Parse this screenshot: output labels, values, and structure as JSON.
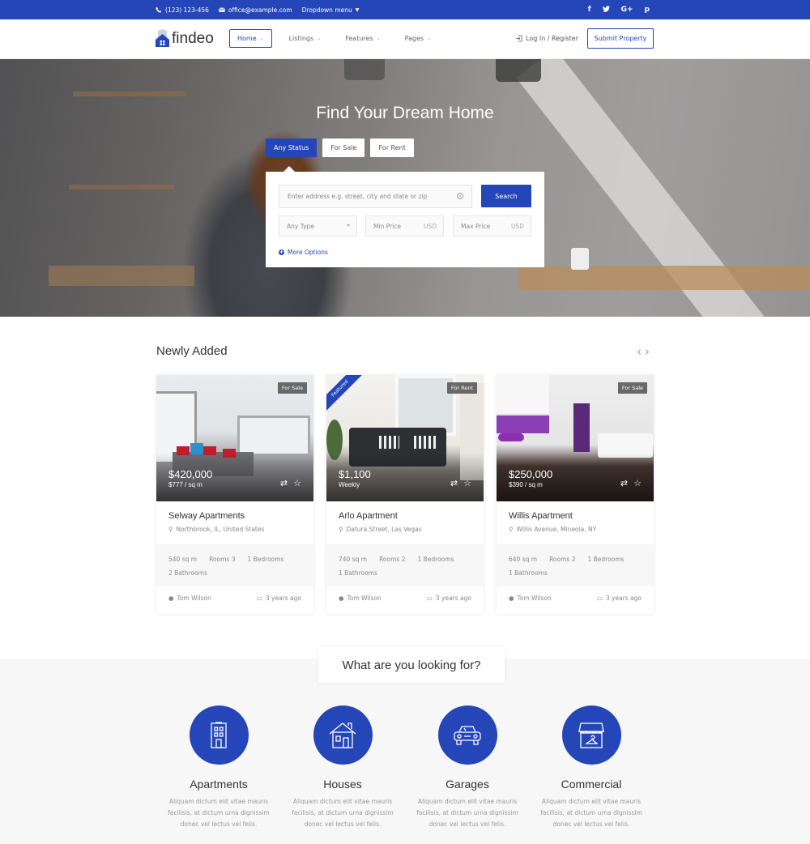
{
  "topbar": {
    "phone": "(123) 123-456",
    "email": "office@example.com",
    "dropdown": "Dropdown menu",
    "social": [
      "f",
      "t",
      "G+",
      "p"
    ]
  },
  "header": {
    "logo": "findeo",
    "nav": [
      {
        "label": "Home",
        "active": true
      },
      {
        "label": "Listings",
        "active": false
      },
      {
        "label": "Features",
        "active": false
      },
      {
        "label": "Pages",
        "active": false
      }
    ],
    "login": "Log In / Register",
    "submit": "Submit Property"
  },
  "hero": {
    "title": "Find Your Dream Home",
    "tabs": [
      {
        "label": "Any Status",
        "active": true
      },
      {
        "label": "For Sale",
        "active": false
      },
      {
        "label": "For Rent",
        "active": false
      }
    ],
    "address_placeholder": "Enter address e.g. street, city and state or zip",
    "search_label": "Search",
    "type_placeholder": "Any Type",
    "min_price_placeholder": "Min Price",
    "max_price_placeholder": "Max Price",
    "currency": "USD",
    "more_options": "More Options"
  },
  "newly_added": {
    "title": "Newly Added",
    "listings": [
      {
        "name": "Selway Apartments",
        "location": "Northbrook, IL, United States",
        "price": "$420,000",
        "sub": "$777 / sq m",
        "badge": "For Sale",
        "featured": false,
        "area": "540 sq m",
        "rooms": "Rooms 3",
        "bedrooms": "1 Bedrooms",
        "bathrooms": "2 Bathrooms",
        "agent": "Tom Wilson",
        "date": "3 years ago"
      },
      {
        "name": "Arlo Apartment",
        "location": "Datura Street, Las Vegas",
        "price": "$1,100",
        "sub": "Weekly",
        "badge": "For Rent",
        "featured": true,
        "featured_label": "Featured",
        "area": "740 sq m",
        "rooms": "Rooms 2",
        "bedrooms": "1 Bedrooms",
        "bathrooms": "1 Bathrooms",
        "agent": "Tom Wilson",
        "date": "3 years ago"
      },
      {
        "name": "Willis Apartment",
        "location": "Willis Avenue, Mineola, NY",
        "price": "$250,000",
        "sub": "$390 / sq m",
        "badge": "For Sale",
        "featured": false,
        "area": "640 sq m",
        "rooms": "Rooms 2",
        "bedrooms": "1 Bedrooms",
        "bathrooms": "1 Bathrooms",
        "agent": "Tom Wilson",
        "date": "3 years ago"
      }
    ]
  },
  "looking_for": {
    "title": "What are you looking for?",
    "categories": [
      {
        "title": "Apartments",
        "icon": "building-icon",
        "desc": "Aliquam dictum elit vitae mauris facilisis, at dictum urna dignissim donec vel lectus vel felis."
      },
      {
        "title": "Houses",
        "icon": "house-icon",
        "desc": "Aliquam dictum elit vitae mauris facilisis, at dictum urna dignissim donec vel lectus vel felis."
      },
      {
        "title": "Garages",
        "icon": "car-icon",
        "desc": "Aliquam dictum elit vitae mauris facilisis, at dictum urna dignissim donec vel lectus vel felis."
      },
      {
        "title": "Commercial",
        "icon": "shop-icon",
        "desc": "Aliquam dictum elit vitae mauris facilisis, at dictum urna dignissim donec vel lectus vel felis."
      }
    ]
  },
  "colors": {
    "accent": "#2446b8"
  }
}
